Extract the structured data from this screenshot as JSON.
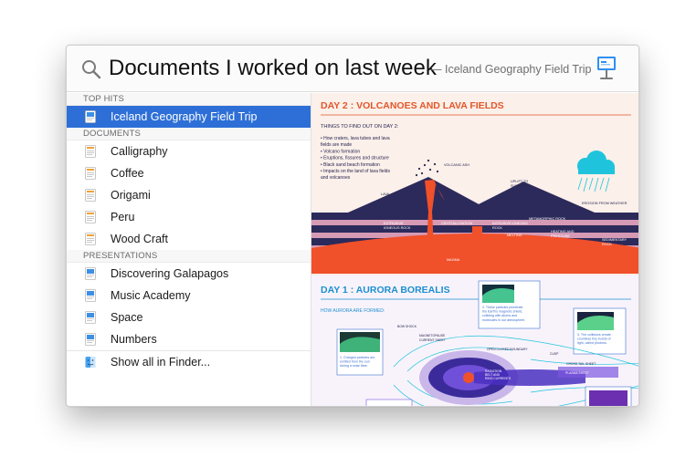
{
  "search": {
    "query": "Documents I worked on last week",
    "suffix": "— Iceland Geography Field Trip",
    "app_icon": "keynote-icon"
  },
  "sections": {
    "top_hits": "TOP HITS",
    "documents": "DOCUMENTS",
    "presentations": "PRESENTATIONS"
  },
  "top_hits": [
    {
      "label": "Iceland Geography Field Trip",
      "icon": "keynote-document-icon",
      "selected": true
    }
  ],
  "documents": [
    {
      "label": "Calligraphy",
      "icon": "pages-document-icon"
    },
    {
      "label": "Coffee",
      "icon": "pages-document-icon"
    },
    {
      "label": "Origami",
      "icon": "pages-document-icon"
    },
    {
      "label": "Peru",
      "icon": "pages-document-icon"
    },
    {
      "label": "Wood Craft",
      "icon": "pages-document-icon"
    }
  ],
  "presentations": [
    {
      "label": "Discovering Galapagos",
      "icon": "keynote-document-icon"
    },
    {
      "label": "Music Academy",
      "icon": "keynote-document-icon"
    },
    {
      "label": "Space",
      "icon": "keynote-document-icon"
    },
    {
      "label": "Numbers",
      "icon": "keynote-document-icon"
    }
  ],
  "show_all": {
    "label": "Show all in Finder...",
    "icon": "finder-icon"
  },
  "preview": {
    "day2_title": "DAY 2 : VOLCANOES AND LAVA FIELDS",
    "day2_subtitle": "THINGS TO FIND OUT ON DAY 2:",
    "day2_bullets": [
      "• How craters, lava tubes and lava",
      "  fields are made",
      "• Volcano formation",
      "• Eruptions, fissures and structure",
      "• Black sand beach formation",
      "• Impacts on the land of lava fields",
      "  and volcanoes"
    ],
    "labels": {
      "volcanic_ash": "VOLCANIC ASH",
      "lava": "LAVA",
      "uplift": "UPLIFT TO",
      "surface": "SURFACE",
      "erosion": "EROSION FROM WEATHER",
      "sedimentation": "SEDIMENTATION",
      "extrusive": "EXTRUSIVE",
      "igneous_rock": "IGNEOUS ROCK",
      "crystallisation": "CRYSTALLISATION",
      "intrusive": "INTRUSIVE IGNEOUS",
      "rock": "ROCK",
      "metamorphic": "METAMORPHIC ROCK",
      "heating": "HEATING AND",
      "pressure": "PRESSURE",
      "melting": "MELTING",
      "sedimentary": "SEDIMENTARY",
      "sed_rock": "ROCK",
      "magma": "MAGMA"
    },
    "day1_title": "DAY 1 : AURORA BOREALIS",
    "day1_subtitle": "HOW AURORA ARE FORMED:",
    "aurora": {
      "step1": [
        "1. Charged particles are",
        "emitted from the sun",
        "during a solar flare."
      ],
      "step2": [
        "2. These particles penetrate",
        "the Earth's magnetic shield,",
        "colliding with atoms and",
        "molecules in our atmosphere."
      ],
      "step3": [
        "3. The collisions create",
        "countless tiny bursts of",
        "light, called photons."
      ],
      "bow_shock": "BOW SHOCK",
      "magnetopause": "MAGNETOPAUSE",
      "current_sheet": "CURRENT SHEET",
      "open_closed": "OPEN CLOSED BOUNDARY",
      "cusp": "CUSP",
      "cross_tail": "CROSS-TAIL SHEET",
      "radiation": "RADIATION",
      "belts": "BELT AND",
      "ring": "RING CURRENTS",
      "plasma": "PLASMA SHEET"
    }
  },
  "colors": {
    "selection": "#2d6fd6",
    "title_orange": "#e2572a",
    "navy": "#25244f",
    "lava": "#f0502a",
    "cyan": "#1fc4dc"
  }
}
